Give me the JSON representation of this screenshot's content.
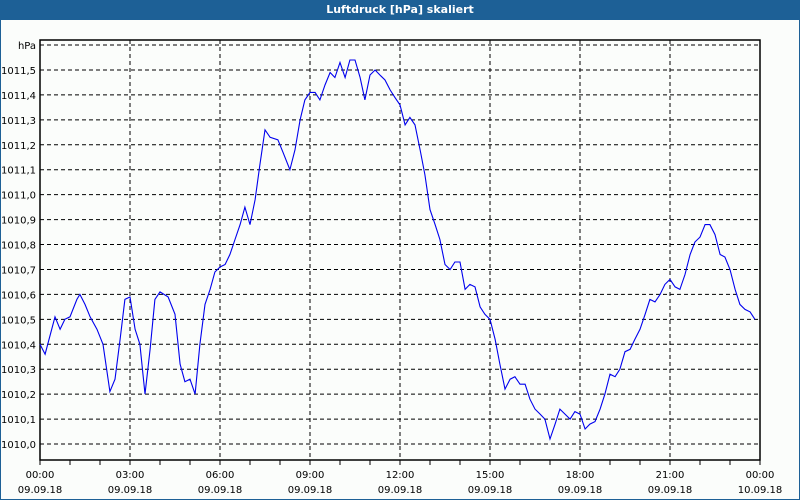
{
  "window": {
    "title": "Luftdruck [hPa] skaliert"
  },
  "chart_data": {
    "type": "line",
    "title": "Luftdruck [hPa] skaliert",
    "ylabel": "hPa",
    "xlabel": "",
    "ylim": [
      1010.0,
      1011.6
    ],
    "xlim_hours": [
      0,
      24
    ],
    "grid": true,
    "line_color": "#0000ee",
    "y_ticks": [
      {
        "v": 1010.0,
        "label": "1010,0"
      },
      {
        "v": 1010.1,
        "label": "1010,1"
      },
      {
        "v": 1010.2,
        "label": "1010,2"
      },
      {
        "v": 1010.3,
        "label": "1010,3"
      },
      {
        "v": 1010.4,
        "label": "1010,4"
      },
      {
        "v": 1010.5,
        "label": "1010,5"
      },
      {
        "v": 1010.6,
        "label": "1010,6"
      },
      {
        "v": 1010.7,
        "label": "1010,7"
      },
      {
        "v": 1010.8,
        "label": "1010,8"
      },
      {
        "v": 1010.9,
        "label": "1010,9"
      },
      {
        "v": 1011.0,
        "label": "1011,0"
      },
      {
        "v": 1011.1,
        "label": "1011,1"
      },
      {
        "v": 1011.2,
        "label": "1011,2"
      },
      {
        "v": 1011.3,
        "label": "1011,3"
      },
      {
        "v": 1011.4,
        "label": "1011,4"
      },
      {
        "v": 1011.5,
        "label": "1011,5"
      }
    ],
    "x_ticks": [
      {
        "h": 0,
        "time": "00:00",
        "date": "09.09.18"
      },
      {
        "h": 3,
        "time": "03:00",
        "date": "09.09.18"
      },
      {
        "h": 6,
        "time": "06:00",
        "date": "09.09.18"
      },
      {
        "h": 9,
        "time": "09:00",
        "date": "09.09.18"
      },
      {
        "h": 12,
        "time": "12:00",
        "date": "09.09.18"
      },
      {
        "h": 15,
        "time": "15:00",
        "date": "09.09.18"
      },
      {
        "h": 18,
        "time": "18:00",
        "date": "09.09.18"
      },
      {
        "h": 21,
        "time": "21:00",
        "date": "09.09.18"
      },
      {
        "h": 24,
        "time": "00:00",
        "date": "10.09.18"
      }
    ],
    "series": [
      {
        "name": "Luftdruck",
        "points": [
          [
            0,
            1010.4
          ],
          [
            0.17,
            1010.36
          ],
          [
            0.5,
            1010.51
          ],
          [
            0.67,
            1010.46
          ],
          [
            0.83,
            1010.5
          ],
          [
            1,
            1010.51
          ],
          [
            1.23,
            1010.58
          ],
          [
            1.33,
            1010.6
          ],
          [
            1.5,
            1010.56
          ],
          [
            1.67,
            1010.51
          ],
          [
            1.9,
            1010.46
          ],
          [
            2.1,
            1010.4
          ],
          [
            2.33,
            1010.21
          ],
          [
            2.5,
            1010.26
          ],
          [
            2.67,
            1010.42
          ],
          [
            2.83,
            1010.58
          ],
          [
            3,
            1010.59
          ],
          [
            3.17,
            1010.46
          ],
          [
            3.33,
            1010.4
          ],
          [
            3.5,
            1010.2
          ],
          [
            3.67,
            1010.38
          ],
          [
            3.83,
            1010.58
          ],
          [
            4,
            1010.61
          ],
          [
            4.27,
            1010.59
          ],
          [
            4.5,
            1010.52
          ],
          [
            4.67,
            1010.32
          ],
          [
            4.83,
            1010.25
          ],
          [
            5,
            1010.26
          ],
          [
            5.17,
            1010.2
          ],
          [
            5.33,
            1010.4
          ],
          [
            5.5,
            1010.56
          ],
          [
            5.67,
            1010.62
          ],
          [
            5.83,
            1010.69
          ],
          [
            6,
            1010.71
          ],
          [
            6.17,
            1010.72
          ],
          [
            6.33,
            1010.76
          ],
          [
            6.5,
            1010.82
          ],
          [
            6.67,
            1010.88
          ],
          [
            6.83,
            1010.95
          ],
          [
            7,
            1010.88
          ],
          [
            7.17,
            1010.98
          ],
          [
            7.33,
            1011.12
          ],
          [
            7.5,
            1011.26
          ],
          [
            7.67,
            1011.23
          ],
          [
            7.93,
            1011.22
          ],
          [
            8.1,
            1011.17
          ],
          [
            8.33,
            1011.1
          ],
          [
            8.5,
            1011.18
          ],
          [
            8.67,
            1011.3
          ],
          [
            8.83,
            1011.38
          ],
          [
            9,
            1011.41
          ],
          [
            9.17,
            1011.41
          ],
          [
            9.33,
            1011.38
          ],
          [
            9.5,
            1011.44
          ],
          [
            9.67,
            1011.49
          ],
          [
            9.83,
            1011.47
          ],
          [
            10,
            1011.53
          ],
          [
            10.17,
            1011.47
          ],
          [
            10.33,
            1011.54
          ],
          [
            10.5,
            1011.54
          ],
          [
            10.67,
            1011.47
          ],
          [
            10.83,
            1011.38
          ],
          [
            11,
            1011.48
          ],
          [
            11.17,
            1011.5
          ],
          [
            11.33,
            1011.48
          ],
          [
            11.5,
            1011.46
          ],
          [
            11.67,
            1011.42
          ],
          [
            11.83,
            1011.39
          ],
          [
            12,
            1011.36
          ],
          [
            12.17,
            1011.28
          ],
          [
            12.33,
            1011.31
          ],
          [
            12.5,
            1011.28
          ],
          [
            12.67,
            1011.18
          ],
          [
            12.83,
            1011.08
          ],
          [
            13,
            1010.94
          ],
          [
            13.17,
            1010.88
          ],
          [
            13.33,
            1010.82
          ],
          [
            13.5,
            1010.72
          ],
          [
            13.67,
            1010.7
          ],
          [
            13.83,
            1010.73
          ],
          [
            14,
            1010.73
          ],
          [
            14.17,
            1010.62
          ],
          [
            14.33,
            1010.64
          ],
          [
            14.5,
            1010.63
          ],
          [
            14.67,
            1010.55
          ],
          [
            14.83,
            1010.52
          ],
          [
            15,
            1010.5
          ],
          [
            15.17,
            1010.42
          ],
          [
            15.33,
            1010.32
          ],
          [
            15.5,
            1010.22
          ],
          [
            15.67,
            1010.26
          ],
          [
            15.83,
            1010.27
          ],
          [
            16,
            1010.24
          ],
          [
            16.17,
            1010.24
          ],
          [
            16.33,
            1010.18
          ],
          [
            16.5,
            1010.14
          ],
          [
            16.67,
            1010.12
          ],
          [
            16.83,
            1010.1
          ],
          [
            17,
            1010.02
          ],
          [
            17.17,
            1010.08
          ],
          [
            17.33,
            1010.14
          ],
          [
            17.5,
            1010.12
          ],
          [
            17.67,
            1010.1
          ],
          [
            17.83,
            1010.13
          ],
          [
            18,
            1010.12
          ],
          [
            18.17,
            1010.06
          ],
          [
            18.33,
            1010.08
          ],
          [
            18.5,
            1010.09
          ],
          [
            18.67,
            1010.14
          ],
          [
            18.83,
            1010.2
          ],
          [
            19,
            1010.28
          ],
          [
            19.17,
            1010.27
          ],
          [
            19.33,
            1010.3
          ],
          [
            19.5,
            1010.37
          ],
          [
            19.67,
            1010.38
          ],
          [
            19.83,
            1010.42
          ],
          [
            20,
            1010.46
          ],
          [
            20.17,
            1010.52
          ],
          [
            20.33,
            1010.58
          ],
          [
            20.5,
            1010.57
          ],
          [
            20.67,
            1010.6
          ],
          [
            20.83,
            1010.64
          ],
          [
            21,
            1010.66
          ],
          [
            21.17,
            1010.63
          ],
          [
            21.33,
            1010.62
          ],
          [
            21.5,
            1010.68
          ],
          [
            21.67,
            1010.76
          ],
          [
            21.83,
            1010.81
          ],
          [
            22,
            1010.83
          ],
          [
            22.17,
            1010.88
          ],
          [
            22.33,
            1010.88
          ],
          [
            22.5,
            1010.84
          ],
          [
            22.67,
            1010.76
          ],
          [
            22.83,
            1010.75
          ],
          [
            23,
            1010.7
          ],
          [
            23.17,
            1010.62
          ],
          [
            23.33,
            1010.56
          ],
          [
            23.5,
            1010.54
          ],
          [
            23.67,
            1010.53
          ],
          [
            23.83,
            1010.5
          ]
        ]
      }
    ]
  }
}
